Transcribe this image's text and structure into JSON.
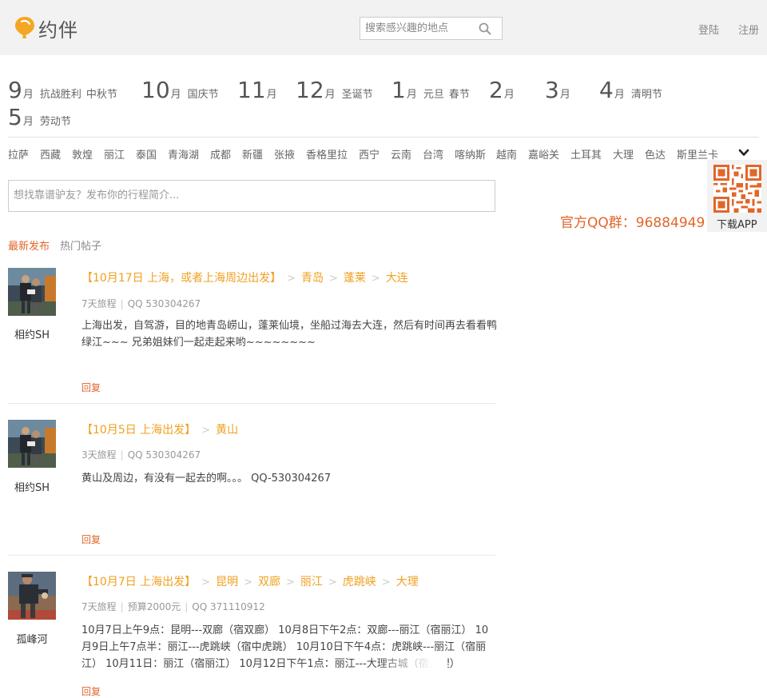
{
  "header": {
    "logo_text": "约伴",
    "search_placeholder": "搜索感兴趣的地点",
    "login": "登陆",
    "register": "注册"
  },
  "months": [
    {
      "num": "9",
      "unit": "月",
      "fests": [
        "抗战胜利",
        "中秋节"
      ]
    },
    {
      "num": "10",
      "unit": "月",
      "fests": [
        "国庆节"
      ]
    },
    {
      "num": "11",
      "unit": "月",
      "fests": []
    },
    {
      "num": "12",
      "unit": "月",
      "fests": [
        "圣诞节"
      ]
    },
    {
      "num": "1",
      "unit": "月",
      "fests": [
        "元旦",
        "春节"
      ]
    },
    {
      "num": "2",
      "unit": "月",
      "fests": []
    },
    {
      "num": "3",
      "unit": "月",
      "fests": []
    },
    {
      "num": "4",
      "unit": "月",
      "fests": [
        "清明节"
      ]
    },
    {
      "num": "5",
      "unit": "月",
      "fests": [
        "劳动节"
      ]
    }
  ],
  "places": [
    "拉萨",
    "西藏",
    "敦煌",
    "丽江",
    "泰国",
    "青海湖",
    "成都",
    "新疆",
    "张掖",
    "香格里拉",
    "西宁",
    "云南",
    "台湾",
    "喀纳斯",
    "越南",
    "嘉峪关",
    "土耳其",
    "大理",
    "色达",
    "斯里兰卡"
  ],
  "post_box": {
    "placeholder": "想找靠谱驴友？发布你的行程简介..."
  },
  "qq_group": "官方QQ群：96884949",
  "app_label": "下载APP",
  "tabs": {
    "latest": "最新发布",
    "hot": "热门帖子"
  },
  "posts": [
    {
      "user": "相约SH",
      "start": "【10月17日 上海，或者上海周边出发】",
      "stops": [
        "青岛",
        "蓬莱",
        "大连"
      ],
      "meta": [
        "7天旅程",
        "QQ 530304267"
      ],
      "desc": "上海出发，自驾游，目的地青岛崂山，蓬莱仙境，坐船过海去大连，然后有时间再去看看鸭绿江~~~ 兄弟姐妹们一起走起来哟~~~~~~~~",
      "reply": "回复"
    },
    {
      "user": "相约SH",
      "start": "【10月5日 上海出发】",
      "stops": [
        "黄山"
      ],
      "meta": [
        "3天旅程",
        "QQ 530304267"
      ],
      "desc": "黄山及周边，有没有一起去的啊。。。 QQ-530304267",
      "reply": "回复"
    },
    {
      "user": "孤峰河",
      "start": "【10月7日 上海出发】",
      "stops": [
        "昆明",
        "双廊",
        "丽江",
        "虎跳峡",
        "大理"
      ],
      "meta": [
        "7天旅程",
        "预算2000元",
        "QQ 371110912"
      ],
      "desc": "10月7日上午9点：昆明---双廊（宿双廊） 10月8日下午2点：双廊---丽江（宿丽江） 10月9日上午7点半：丽江---虎跳峡（宿中虎跳） 10月10日下午4点：虎跳峡---丽江（宿丽江） 10月11日：丽江（宿丽江） 10月12日下午1点：丽江---大理古城（宿大理）",
      "reply": "回复"
    }
  ]
}
